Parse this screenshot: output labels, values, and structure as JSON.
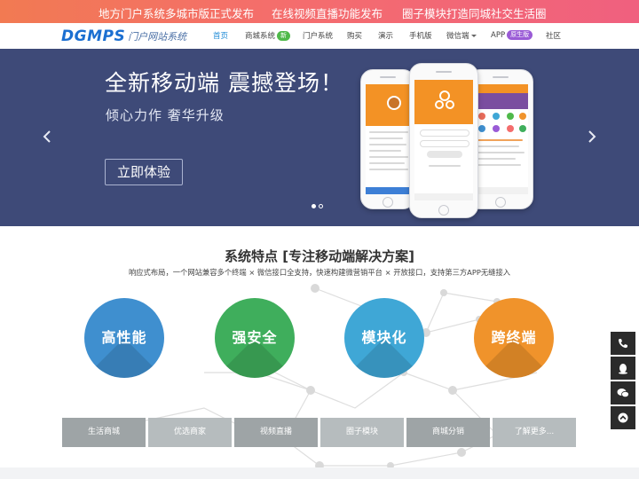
{
  "announcements": [
    "地方门户系统多城市版正式发布",
    "在线视频直播功能发布",
    "圈子模块打造同城社交生活圈"
  ],
  "logo": {
    "mark": "DGMPS",
    "text": "门户网站系统"
  },
  "nav": {
    "items": [
      {
        "label": "首页",
        "active": true
      },
      {
        "label": "商城系统",
        "badge": "新"
      },
      {
        "label": "门户系统"
      },
      {
        "label": "购买"
      },
      {
        "label": "演示"
      },
      {
        "label": "手机版"
      },
      {
        "label": "微信端"
      },
      {
        "label": "APP",
        "badge": "原生版"
      },
      {
        "label": "社区"
      }
    ]
  },
  "banner": {
    "title": "全新移动端 震撼登场！",
    "subtitle": "倾心力作 奢华升级",
    "cta": "立即体验",
    "slides": 2,
    "active_slide": 1
  },
  "features": {
    "title": "系统特点 [专注移动端解决方案]",
    "description": "响应式布局，一个网站兼容多个终端 × 微信接口全支持，快速构建微营销平台 × 开放接口，支持第三方APP无缝接入",
    "circles": [
      "高性能",
      "强安全",
      "模块化",
      "跨终端"
    ],
    "tabs": [
      "生活商城",
      "优选商家",
      "视频直播",
      "圈子模块",
      "商城分销",
      "了解更多..."
    ]
  },
  "colors": {
    "topbar_start": "#f27a52",
    "topbar_end": "#f0607f",
    "banner_bg": "#3e4a78",
    "nav_active": "#1e8ad6",
    "circle_blue": "#3f8fcf",
    "circle_green": "#3fae5c",
    "circle_cyan": "#3fa7d6",
    "circle_orange": "#f0932b"
  },
  "side_tools": [
    "phone-icon",
    "qq-icon",
    "wechat-icon",
    "back-to-top-icon"
  ]
}
